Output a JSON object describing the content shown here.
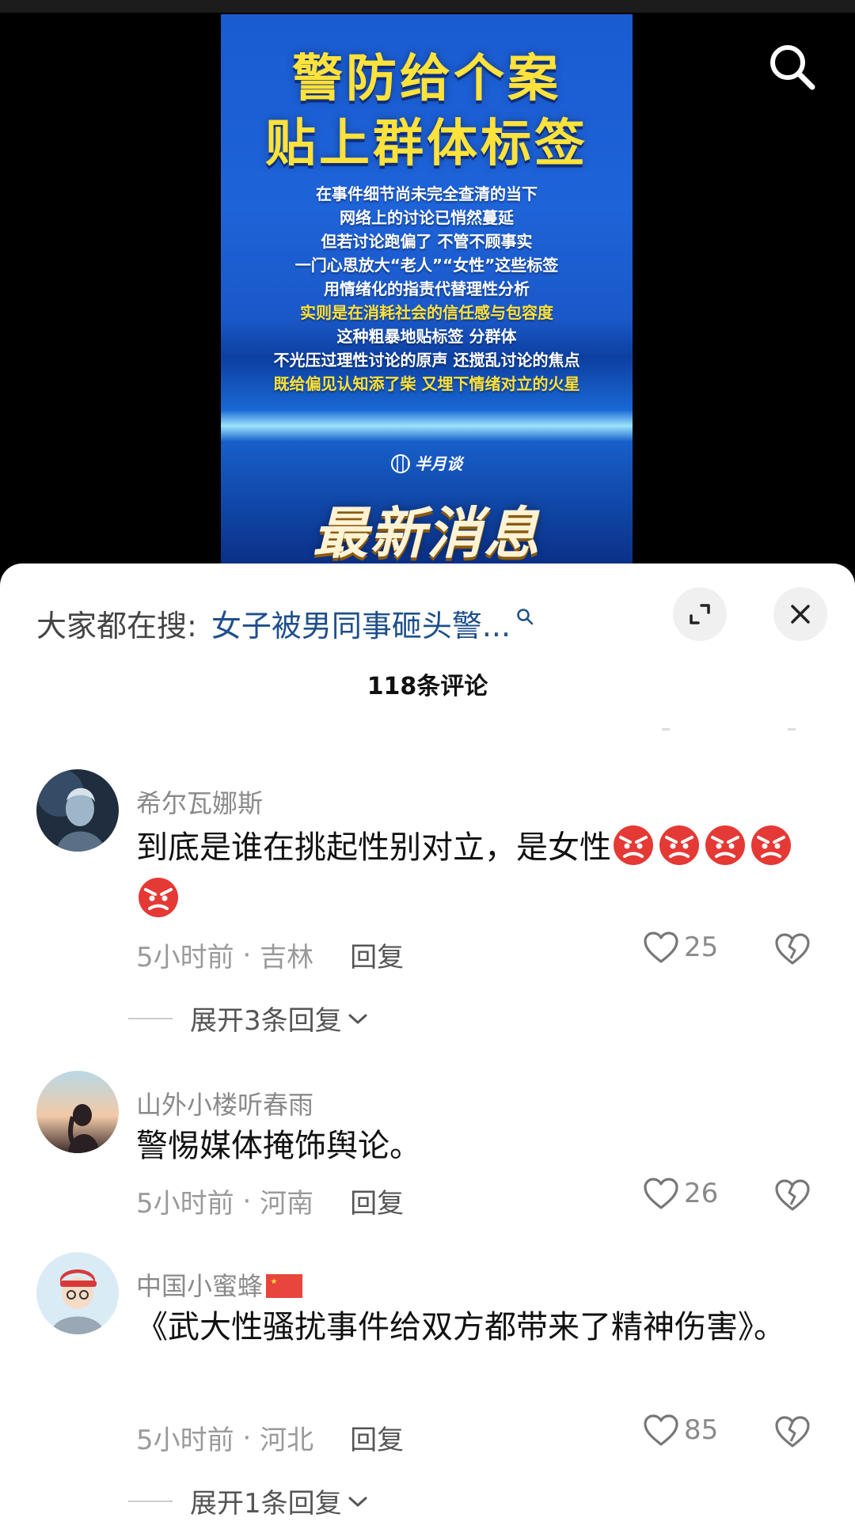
{
  "video": {
    "poster": {
      "title_line1": "警防给个案",
      "title_line2": "贴上群体标签",
      "lines": [
        "在事件细节尚未完全查清的当下",
        "网络上的讨论已悄然蔓延",
        "但若讨论跑偏了 不管不顾事实",
        "一门心思放大“老人”“女性”这些标签",
        "用情绪化的指责代替理性分析",
        "实则是在消耗社会的信任感与包容度",
        "这种粗暴地贴标签 分群体",
        "不光压过理性讨论的原声 还搅乱讨论的焦点",
        "既给偏见认知添了柴 又埋下情绪对立的火星"
      ],
      "logo": "半月谈",
      "banner": "最新消息"
    },
    "search_icon": "search-icon"
  },
  "sheet": {
    "hot_search_label": "大家都在搜:",
    "hot_search_query": "女子被男同事砸头警...",
    "comment_count": "118条评论",
    "icons": {
      "expand": "expand-icon",
      "close": "close-icon"
    }
  },
  "comments": [
    {
      "username": "希尔瓦娜斯",
      "text": "到底是谁在挑起性别对立，是女性",
      "emoji_count": 5,
      "emoji": "angry-face-emoji",
      "time": "5小时前",
      "location": "吉林",
      "reply_label": "回复",
      "likes": "25",
      "expand_replies": "展开3条回复"
    },
    {
      "username": "山外小楼听春雨",
      "text": "警惕媒体掩饰舆论。",
      "time": "5小时前",
      "location": "河南",
      "reply_label": "回复",
      "likes": "26"
    },
    {
      "username": "中国小蜜蜂",
      "text": "《武大性骚扰事件给双方都带来了精神伤害》。",
      "time": "5小时前",
      "location": "河北",
      "reply_label": "回复",
      "likes": "85",
      "expand_replies": "展开1条回复"
    }
  ],
  "colors": {
    "accent_link": "#1e4f8a",
    "poster_yellow": "#ffe23b",
    "poster_blue": "#1e63d8"
  }
}
